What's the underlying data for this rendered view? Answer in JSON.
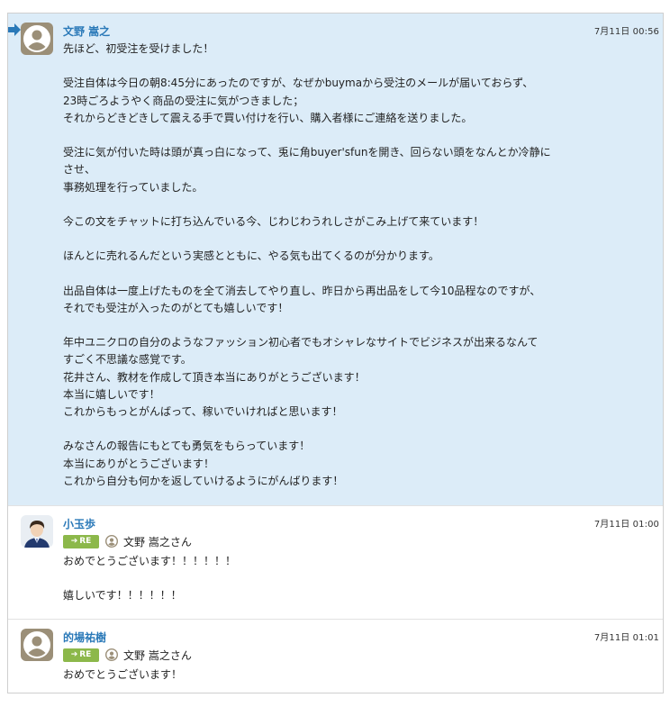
{
  "messages": [
    {
      "sender": "文野 嵩之",
      "time": "7月11日 00:56",
      "avatar": "default-user-icon",
      "highlighted": true,
      "lines": [
        "先ほど、初受注を受けました！",
        "",
        "受注自体は今日の朝8:45分にあったのですが、なぜかbuymaから受注のメールが届いておらず、",
        "23時ごろようやく商品の受注に気がつきました；",
        "それからどきどきして震える手で買い付けを行い、購入者様にご連絡を送りました。",
        "",
        "受注に気が付いた時は頭が真っ白になって、兎に角buyer'sfunを開き、回らない頭をなんとか冷静に",
        "させ、",
        "事務処理を行っていました。",
        "",
        "今この文をチャットに打ち込んでいる今、じわじわうれしさがこみ上げて来ています！",
        "",
        "ほんとに売れるんだという実感とともに、やる気も出てくるのが分かります。",
        "",
        "出品自体は一度上げたものを全て消去してやり直し、昨日から再出品をして今10品程なのですが、",
        "それでも受注が入ったのがとても嬉しいです！",
        "",
        "年中ユニクロの自分のようなファッション初心者でもオシャレなサイトでビジネスが出来るなんて",
        "すごく不思議な感覚です。",
        "花井さん、教材を作成して頂き本当にありがとうございます！",
        "本当に嬉しいです！",
        "これからもっとがんばって、稼いでいければと思います！",
        "",
        "みなさんの報告にもとても勇気をもらっています！",
        "本当にありがとうございます！",
        "これから自分も何かを返していけるようにがんばります！"
      ]
    },
    {
      "sender": "小玉歩",
      "time": "7月11日 01:00",
      "avatar": "user-photo",
      "re_label": "RE",
      "reply_to": "文野 嵩之さん",
      "lines": [
        "おめでとうございます！！！！！！",
        "",
        "嬉しいです！！！！！！"
      ]
    },
    {
      "sender": "的場祐樹",
      "time": "7月11日 01:01",
      "avatar": "default-user-icon",
      "re_label": "RE",
      "reply_to": "文野 嵩之さん",
      "lines": [
        "おめでとうございます！"
      ]
    }
  ],
  "colors": {
    "highlight_bg": "#dcecf8",
    "sender_name": "#2a79b8",
    "re_badge": "#8cb84a",
    "pointer_arrow": "#2a79b8"
  }
}
